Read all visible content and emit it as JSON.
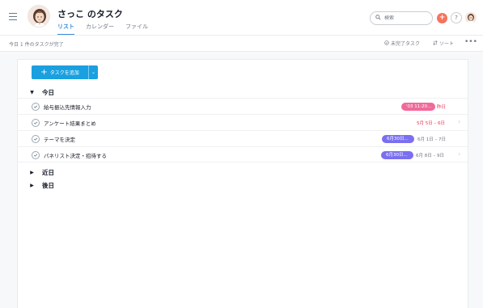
{
  "header": {
    "title": "さっこ のタスク",
    "tabs": [
      {
        "label": "リスト",
        "active": true
      },
      {
        "label": "カレンダー",
        "active": false
      },
      {
        "label": "ファイル",
        "active": false
      }
    ],
    "search_placeholder": "検索",
    "add_icon": "plus-icon",
    "help_label": "?",
    "accent_color": "#3d8ad6"
  },
  "subbar": {
    "status": "今日 1 件のタスクが完了",
    "filter_label": "未完了タスク",
    "sort_label": "ソート",
    "more_label": "•••"
  },
  "toolbar": {
    "add_task_label": "タスクを追加",
    "add_task_color": "#1aa0e0"
  },
  "sections": {
    "today": {
      "label": "今日"
    },
    "soon": {
      "label": "近日"
    },
    "later": {
      "label": "後日"
    }
  },
  "tasks": [
    {
      "name": "給与振込先情報入力",
      "tag": "'03 11:20...",
      "tag_color": "#f06a99",
      "due": "昨日",
      "due_overdue": true
    },
    {
      "name": "アンケート結果まとめ",
      "tag": "",
      "due": "5月 5日 – 6日",
      "due_overdue": true
    },
    {
      "name": "テーマを決定",
      "tag": "6月30日...",
      "tag_color": "#7a6ff0",
      "due": "6月 1日 – 7日",
      "due_overdue": false
    },
    {
      "name": "パネリスト決定・招待する",
      "tag": "6月30日...",
      "tag_color": "#7a6ff0",
      "due": "6月 8日 – 9日",
      "due_overdue": false
    }
  ]
}
